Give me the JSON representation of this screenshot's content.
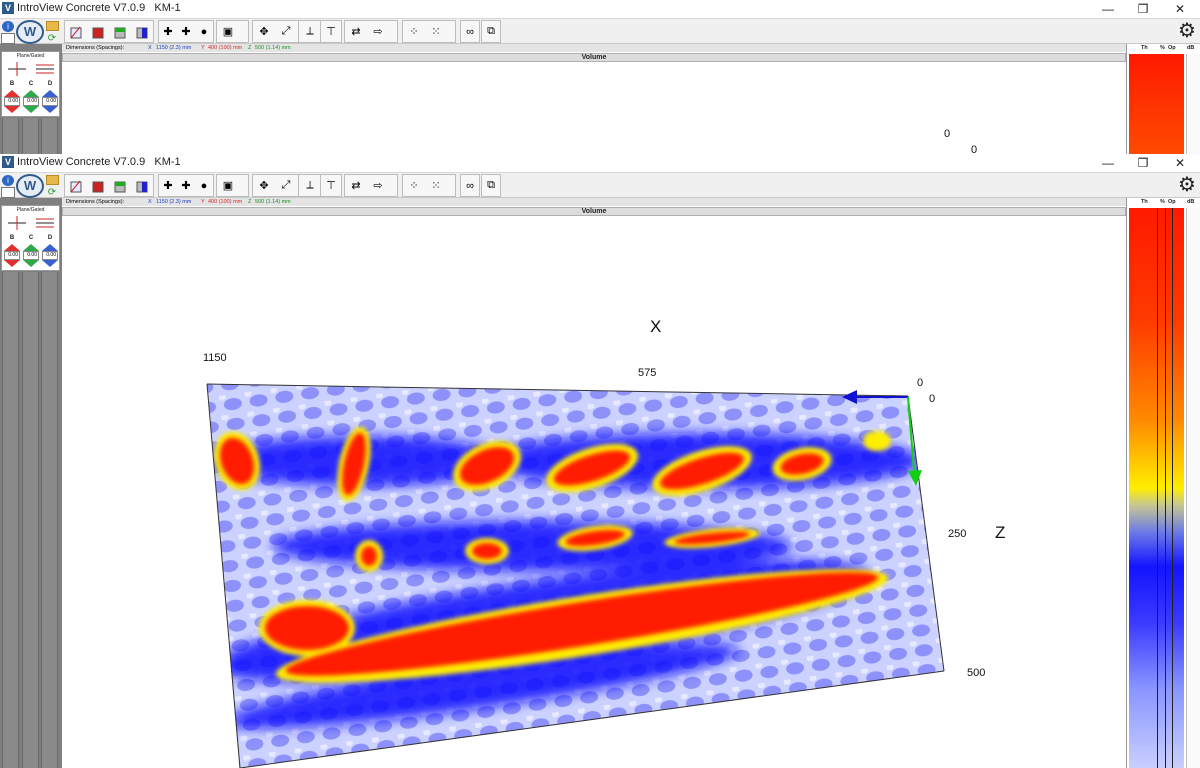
{
  "app": {
    "title": "IntroView Concrete V7.0.9   KM-1",
    "logo_letter": "V",
    "minimize": "—",
    "restore": "❐",
    "close": "✕"
  },
  "toolbar": {
    "info": "i",
    "home": "W",
    "refresh": "⟳"
  },
  "dimensions": {
    "label": "Dimensions (Spacings):",
    "x_label": "X",
    "x_value": "1150 (2.3) mm",
    "y_label": "Y",
    "y_value": "400 (100) mm",
    "z_label": "Z",
    "z_value": "500 (1.14) mm",
    "x_color": "#1f3fbf",
    "y_color": "#d42a2a",
    "z_color": "#1f8f2a"
  },
  "view_header": "Volume",
  "left_panel": {
    "title": "Plane/Gated",
    "letters": [
      "B",
      "C",
      "D"
    ],
    "values": [
      "0.00",
      "0.00",
      "0.00"
    ]
  },
  "right_panel": {
    "headers": [
      "Th",
      "%",
      "Op",
      "dB"
    ]
  },
  "viewport_top": {
    "label_a": "0",
    "label_b": "0"
  },
  "viewport_main": {
    "x_title": "X",
    "z_title": "Z",
    "x_ticks": [
      "1150",
      "575",
      "0"
    ],
    "z_ticks": [
      "0",
      "250",
      "500"
    ]
  },
  "colors": {
    "red": "#ff1a00",
    "yellow": "#ffee00",
    "blue": "#1414ff",
    "light_blue": "#d6dcff"
  }
}
